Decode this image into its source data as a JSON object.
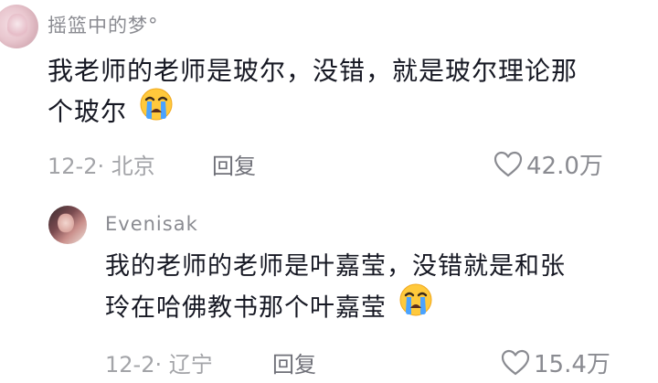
{
  "comments": [
    {
      "username": "摇篮中的梦°",
      "line1": "我老师的老师是玻尔，没错，就是玻尔理论那",
      "line2": "个玻尔",
      "emoji": "crying-face-icon",
      "date_location": "12-2· 北京",
      "reply_label": "回复",
      "likes": "42.0万"
    },
    {
      "username": "Evenisak",
      "line1": "我的老师的老师是叶嘉莹，没错就是和张",
      "line2": "玲在哈佛教书那个叶嘉莹",
      "emoji": "crying-face-icon",
      "date_location": "12-2· 辽宁",
      "reply_label": "回复",
      "likes": "15.4万"
    }
  ],
  "colors": {
    "text": "#161823",
    "secondary": "#8a8b91",
    "meta": "#a3a4a8",
    "emoji_yellow": "#ffc93c",
    "emoji_tears": "#4aa3ff"
  }
}
